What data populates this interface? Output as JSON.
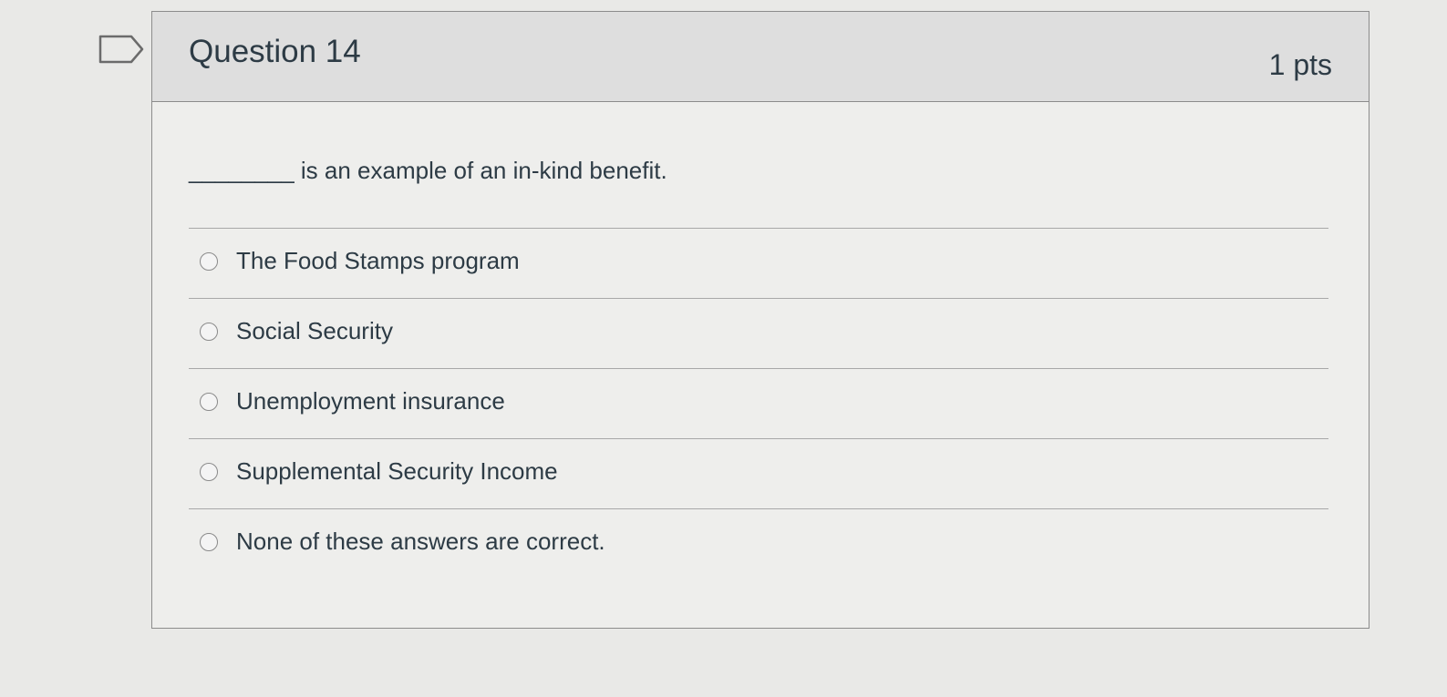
{
  "question": {
    "title": "Question 14",
    "points": "1 pts",
    "text": "________ is an example of an in-kind benefit.",
    "answers": [
      {
        "label": "The Food Stamps program"
      },
      {
        "label": "Social Security"
      },
      {
        "label": "Unemployment insurance"
      },
      {
        "label": "Supplemental Security Income"
      },
      {
        "label": "None of these answers are correct."
      }
    ]
  },
  "icons": {
    "flag": "bookmark-flag-icon",
    "radio": "radio-button-icon"
  },
  "colors": {
    "text": "#2d3b45",
    "header_bg": "#dedede",
    "border": "#8c8c8c"
  }
}
